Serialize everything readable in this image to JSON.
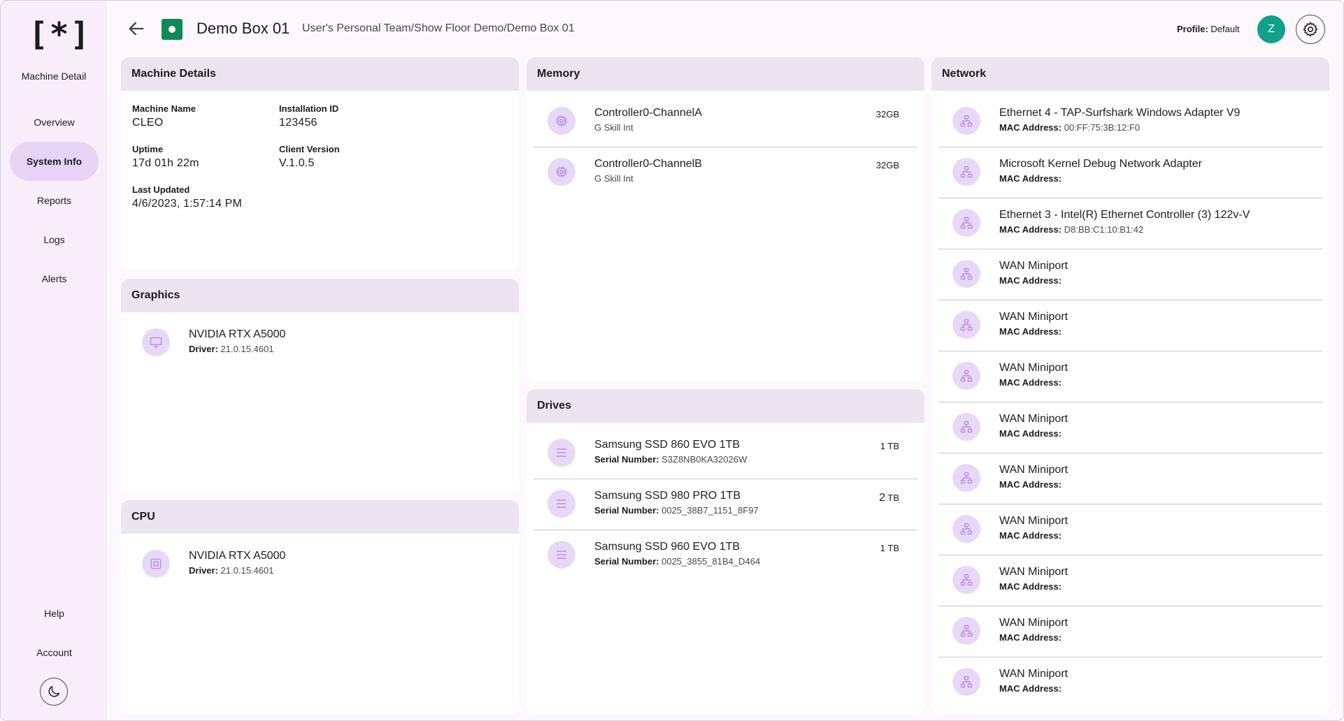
{
  "sidebar": {
    "logo": "[*]",
    "title": "Machine Detail",
    "items": [
      {
        "label": "Overview"
      },
      {
        "label": "System Info"
      },
      {
        "label": "Reports"
      },
      {
        "label": "Logs"
      },
      {
        "label": "Alerts"
      }
    ],
    "bottom_items": [
      {
        "label": "Help"
      },
      {
        "label": "Account"
      }
    ]
  },
  "header": {
    "title": "Demo Box 01",
    "breadcrumb": "User's Personal Team/Show Floor Demo/Demo Box 01",
    "profile_label": "Profile:",
    "profile_value": "Default",
    "avatar_initial": "Z",
    "status_color": "#0e8a55"
  },
  "machine_details": {
    "title": "Machine Details",
    "machine_name_label": "Machine Name",
    "machine_name": "CLEO",
    "installation_id_label": "Installation ID",
    "installation_id": "123456",
    "uptime_label": "Uptime",
    "uptime": "17d 01h 22m",
    "client_version_label": "Client Version",
    "client_version": "V.1.0.5",
    "last_updated_label": "Last Updated",
    "last_updated": "4/6/2023, 1:57:14 PM"
  },
  "graphics": {
    "title": "Graphics",
    "items": [
      {
        "name": "NVIDIA RTX A5000",
        "driver_label": "Driver:",
        "driver": "21.0.15.4601"
      }
    ]
  },
  "cpu": {
    "title": "CPU",
    "items": [
      {
        "name": "NVIDIA RTX A5000",
        "driver_label": "Driver:",
        "driver": "21.0.15.4601"
      }
    ]
  },
  "memory": {
    "title": "Memory",
    "items": [
      {
        "name": "Controller0-ChannelA",
        "vendor": "G Skill Int",
        "size": "32GB"
      },
      {
        "name": "Controller0-ChannelB",
        "vendor": "G Skill Int",
        "size": "32GB"
      }
    ]
  },
  "drives": {
    "title": "Drives",
    "serial_label": "Serial Number:",
    "items": [
      {
        "name": "Samsung SSD 860 EVO 1TB",
        "serial": "S3Z8NB0KA32026W",
        "size_num": "1",
        "size_unit": "TB"
      },
      {
        "name": "Samsung SSD 980 PRO 1TB",
        "serial": "0025_38B7_1151_8F97",
        "size_num": "2",
        "size_unit": "TB"
      },
      {
        "name": "Samsung SSD 960 EVO 1TB",
        "serial": "0025_3855_81B4_D464",
        "size_num": "1",
        "size_unit": "TB"
      }
    ]
  },
  "network": {
    "title": "Network",
    "mac_label": "MAC Address:",
    "items": [
      {
        "name": "Ethernet 4 - TAP-Surfshark Windows Adapter V9",
        "mac": "00:FF:75:3B:12:F0"
      },
      {
        "name": "Microsoft Kernel Debug Network Adapter",
        "mac": ""
      },
      {
        "name": "Ethernet 3 - Intel(R) Ethernet Controller (3) 122v-V",
        "mac": "D8:BB:C1:10:B1:42"
      },
      {
        "name": "WAN Miniport",
        "mac": ""
      },
      {
        "name": "WAN Miniport",
        "mac": ""
      },
      {
        "name": "WAN Miniport",
        "mac": ""
      },
      {
        "name": "WAN Miniport",
        "mac": ""
      },
      {
        "name": "WAN Miniport",
        "mac": ""
      },
      {
        "name": "WAN Miniport",
        "mac": ""
      },
      {
        "name": "WAN Miniport",
        "mac": ""
      },
      {
        "name": "WAN Miniport",
        "mac": ""
      },
      {
        "name": "WAN Miniport",
        "mac": ""
      }
    ]
  },
  "icons": {
    "back": "arrow-back-icon",
    "settings": "gear-icon",
    "theme": "moon-icon",
    "memory": "chip-icon",
    "drive": "storage-icon",
    "network": "network-icon",
    "graphics": "monitor-icon",
    "cpu": "cpu-icon"
  },
  "colors": {
    "accent": "#e6d3f6",
    "icon_bg": "#e8d8f7",
    "icon_fg": "#b693e0",
    "avatar": "#12a08a"
  }
}
